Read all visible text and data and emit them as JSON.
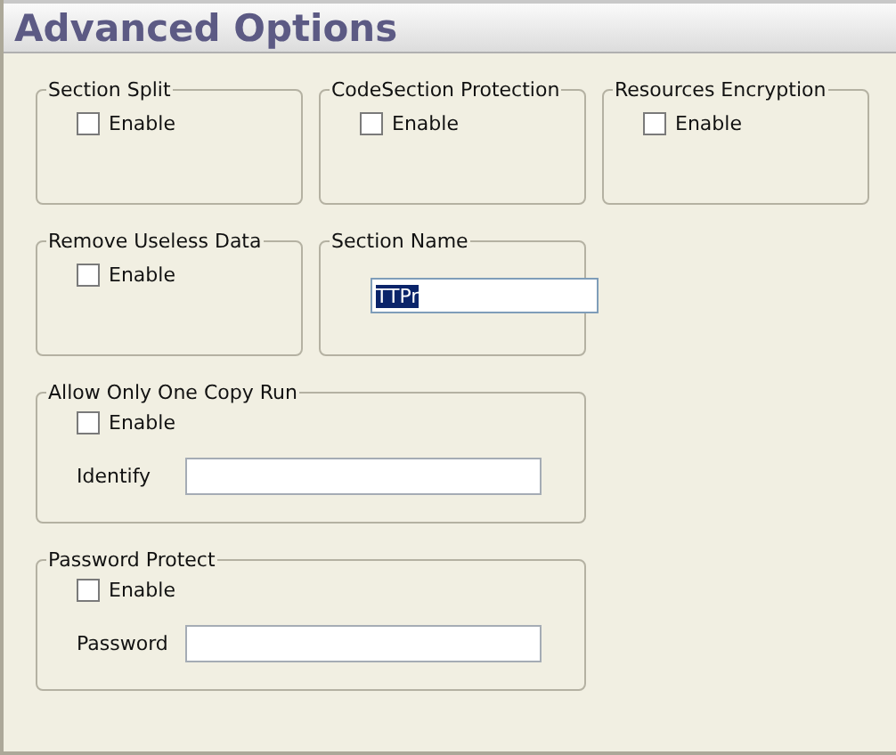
{
  "window": {
    "title": "Advanced Options"
  },
  "groups": [
    {
      "title": "Section Split",
      "kind": "checkbox",
      "checkbox": {
        "label": "Enable",
        "checked": false
      }
    },
    {
      "title": "CodeSection Protection",
      "kind": "checkbox",
      "checkbox": {
        "label": "Enable",
        "checked": false
      }
    },
    {
      "title": "Resources Encryption",
      "kind": "checkbox",
      "checkbox": {
        "label": "Enable",
        "checked": false
      }
    },
    {
      "title": "Remove Useless Data",
      "kind": "checkbox",
      "checkbox": {
        "label": "Enable",
        "checked": false
      }
    },
    {
      "title": "Section Name",
      "kind": "field",
      "field": {
        "value": "TTPr",
        "highlighted": true
      }
    },
    {
      "title": "Allow Only One Copy Run",
      "kind": "checkbox_field",
      "checkbox": {
        "label": "Enable",
        "checked": false
      },
      "field": {
        "label": "Identify"
      }
    },
    {
      "title": "Password Protect",
      "kind": "checkbox_field",
      "checkbox": {
        "label": "Enable",
        "checked": false
      },
      "field": {
        "label": "Password"
      }
    }
  ]
}
